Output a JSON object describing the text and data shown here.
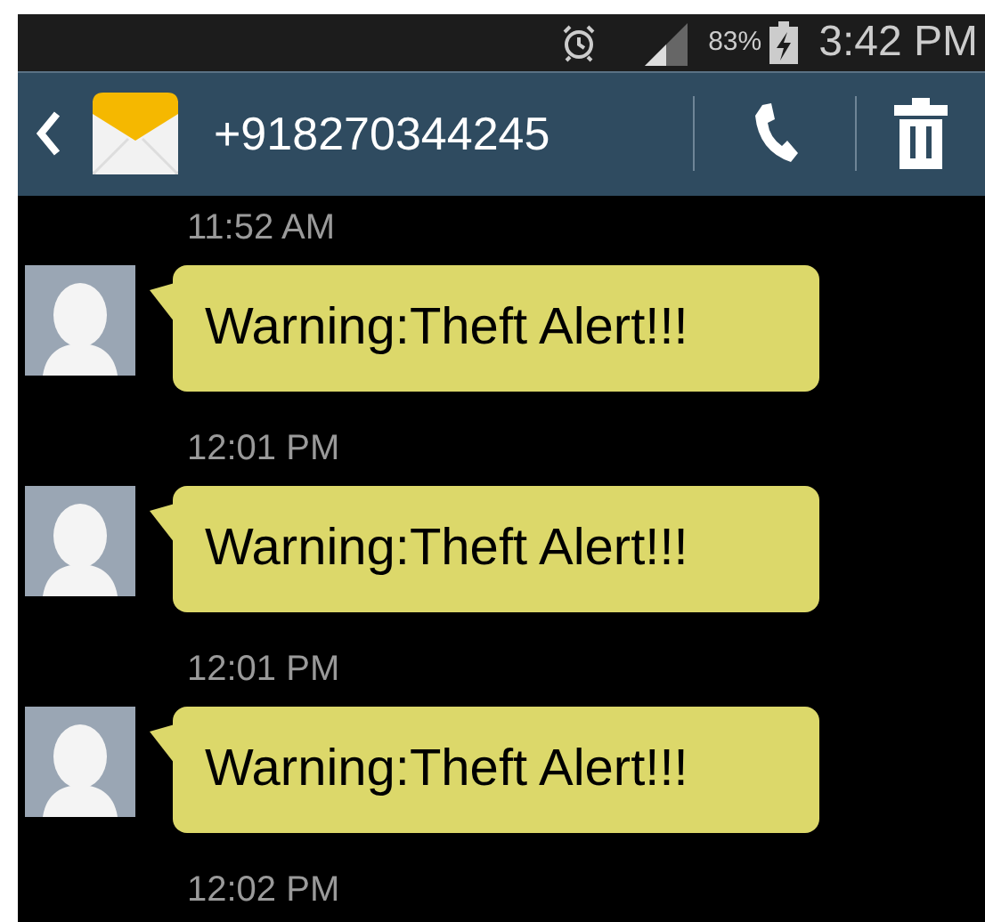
{
  "status_bar": {
    "battery": "83%",
    "time": "3:42 PM"
  },
  "header": {
    "contact": "+918270344245"
  },
  "messages": [
    {
      "time": "11:52 AM",
      "text": "Warning:Theft Alert!!!"
    },
    {
      "time": "12:01 PM",
      "text": "Warning:Theft Alert!!!"
    },
    {
      "time": "12:01 PM",
      "text": "Warning:Theft Alert!!!"
    }
  ],
  "last_time": "12:02 PM"
}
